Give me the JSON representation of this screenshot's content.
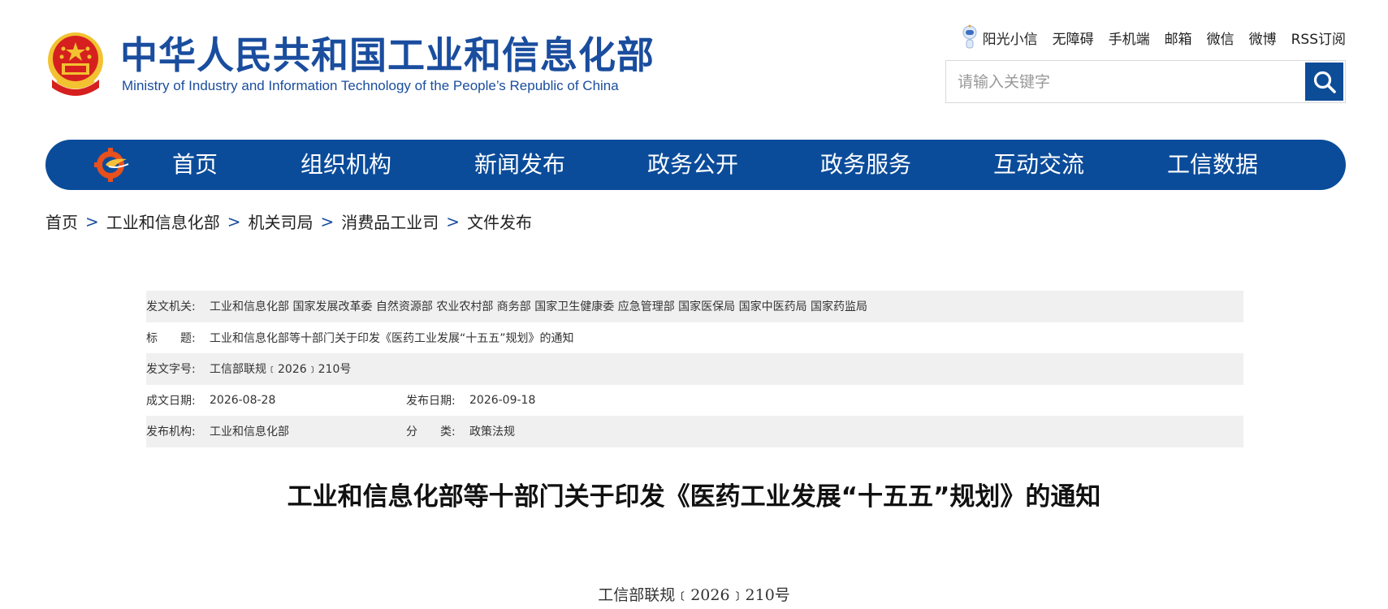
{
  "header": {
    "title_cn": "中华人民共和国工业和信息化部",
    "title_en": "Ministry of Industry and Information Technology of the People’s Republic of China"
  },
  "top_links": [
    "阳光小信",
    "无障碍",
    "手机端",
    "邮箱",
    "微信",
    "微博",
    "RSS订阅"
  ],
  "search": {
    "placeholder": "请输入关键字"
  },
  "nav": [
    "首页",
    "组织机构",
    "新闻发布",
    "政务公开",
    "政务服务",
    "互动交流",
    "工信数据"
  ],
  "breadcrumb": [
    "首页",
    "工业和信息化部",
    "机关司局",
    "消费品工业司",
    "文件发布"
  ],
  "breadcrumb_sep": ">",
  "meta": {
    "issuer_label": "发文机关:",
    "issuer_value": "工业和信息化部 国家发展改革委 自然资源部 农业农村部 商务部 国家卫生健康委 应急管理部 国家医保局 国家中医药局 国家药监局",
    "title_label": "标　　题:",
    "title_value": "工业和信息化部等十部门关于印发《医药工业发展“十五五”规划》的通知",
    "docno_label": "发文字号:",
    "docno_value": "工信部联规﹝2026﹞210号",
    "created_label": "成文日期:",
    "created_value": "2026-08-28",
    "published_label": "发布日期:",
    "published_value": "2026-09-18",
    "org_label": "发布机构:",
    "org_value": "工业和信息化部",
    "category_label": "分　　类:",
    "category_value": "政策法规"
  },
  "article": {
    "title": "工业和信息化部等十部门关于印发《医药工业发展“十五五”规划》的通知",
    "doc_number": "工信部联规﹝2026﹞210号"
  },
  "colors": {
    "brand_blue": "#0b4c9a",
    "title_blue": "#1a4d9e",
    "emblem_red": "#d6201f",
    "emblem_gold": "#f2c230"
  }
}
